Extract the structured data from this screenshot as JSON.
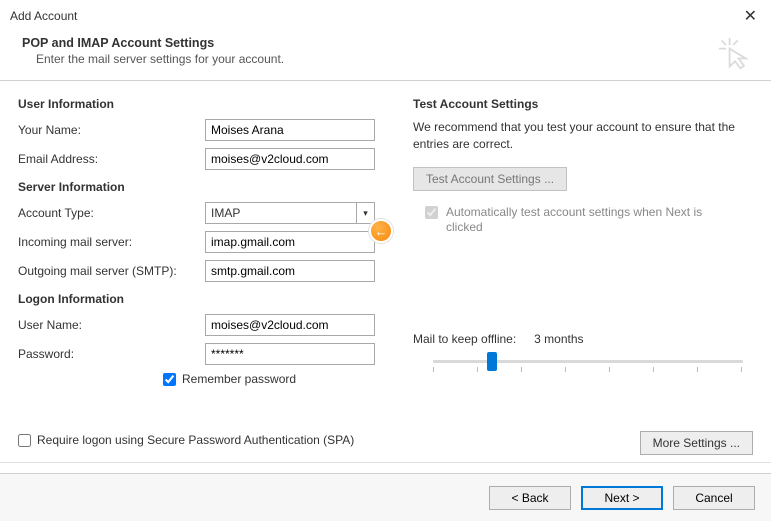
{
  "window": {
    "title": "Add Account"
  },
  "header": {
    "title": "POP and IMAP Account Settings",
    "subtitle": "Enter the mail server settings for your account."
  },
  "left": {
    "user_info_title": "User Information",
    "your_name_label": "Your Name:",
    "your_name_value": "Moises Arana",
    "email_label": "Email Address:",
    "email_value": "moises@v2cloud.com",
    "server_info_title": "Server Information",
    "account_type_label": "Account Type:",
    "account_type_value": "IMAP",
    "incoming_label": "Incoming mail server:",
    "incoming_value": "imap.gmail.com",
    "outgoing_label": "Outgoing mail server (SMTP):",
    "outgoing_value": "smtp.gmail.com",
    "logon_info_title": "Logon Information",
    "username_label": "User Name:",
    "username_value": "moises@v2cloud.com",
    "password_label": "Password:",
    "password_value": "*******",
    "remember_label": "Remember password",
    "spa_label": "Require logon using Secure Password Authentication (SPA)"
  },
  "right": {
    "test_title": "Test Account Settings",
    "test_desc": "We recommend that you test your account to ensure that the entries are correct.",
    "test_button": "Test Account Settings ...",
    "auto_test_label": "Automatically test account settings when Next is clicked",
    "mail_offline_label": "Mail to keep offline:",
    "mail_offline_value": "3 months",
    "more_settings": "More Settings ..."
  },
  "footer": {
    "back": "< Back",
    "next": "Next >",
    "cancel": "Cancel"
  }
}
